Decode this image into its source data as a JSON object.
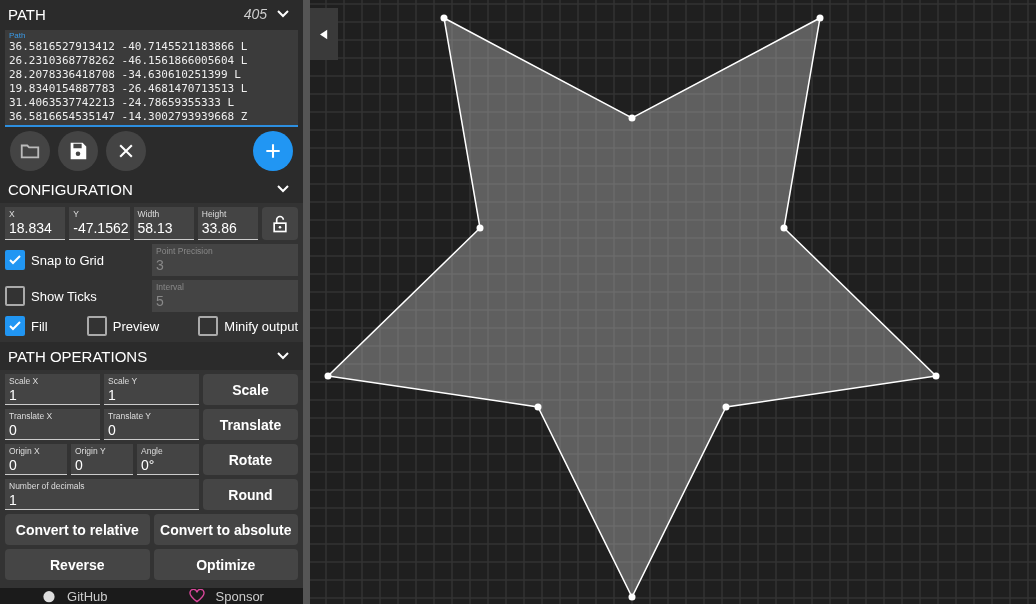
{
  "path_panel": {
    "title": "PATH",
    "count": "405",
    "expanded": true,
    "field_label": "Path",
    "lines": [
      "36.5816527913412 -40.7145521183866 L",
      "26.2310368778262 -46.1561866005604 L",
      "28.2078336418708 -34.630610251399 L",
      "19.8340154887783 -26.4681470713513 L",
      "31.4063537742213 -24.78659355333 L",
      "36.5816654535147 -14.3002793939668 Z"
    ]
  },
  "configuration": {
    "title": "CONFIGURATION",
    "expanded": true,
    "fields": [
      {
        "label": "X",
        "value": "18.834"
      },
      {
        "label": "Y",
        "value": "-47.1562"
      },
      {
        "label": "Width",
        "value": "58.13"
      },
      {
        "label": "Height",
        "value": "33.86"
      }
    ],
    "locked": false,
    "snap_to_grid": {
      "label": "Snap to Grid",
      "checked": true
    },
    "point_precision": {
      "label": "Point Precision",
      "value": "3",
      "disabled": true
    },
    "show_ticks": {
      "label": "Show Ticks",
      "checked": false
    },
    "interval": {
      "label": "Interval",
      "value": "5",
      "disabled": true
    },
    "options": [
      {
        "label": "Fill",
        "checked": true
      },
      {
        "label": "Preview",
        "checked": false
      },
      {
        "label": "Minify output",
        "checked": false
      }
    ]
  },
  "path_operations": {
    "title": "PATH OPERATIONS",
    "expanded": true,
    "rows": [
      {
        "fields": [
          {
            "label": "Scale X",
            "value": "1"
          },
          {
            "label": "Scale Y",
            "value": "1"
          }
        ],
        "button": "Scale"
      },
      {
        "fields": [
          {
            "label": "Translate X",
            "value": "0"
          },
          {
            "label": "Translate Y",
            "value": "0"
          }
        ],
        "button": "Translate"
      },
      {
        "fields": [
          {
            "label": "Origin X",
            "value": "0"
          },
          {
            "label": "Origin Y",
            "value": "0"
          },
          {
            "label": "Angle",
            "value": "0°"
          }
        ],
        "button": "Rotate"
      },
      {
        "fields": [
          {
            "label": "Number of decimals",
            "value": "1"
          }
        ],
        "button": "Round"
      }
    ],
    "wide_buttons": [
      "Convert to relative",
      "Convert to absolute",
      "Reverse",
      "Optimize"
    ]
  },
  "footer": [
    {
      "kind": "github",
      "label": "GitHub"
    },
    {
      "kind": "sponsor",
      "label": "Sponsor"
    }
  ]
}
